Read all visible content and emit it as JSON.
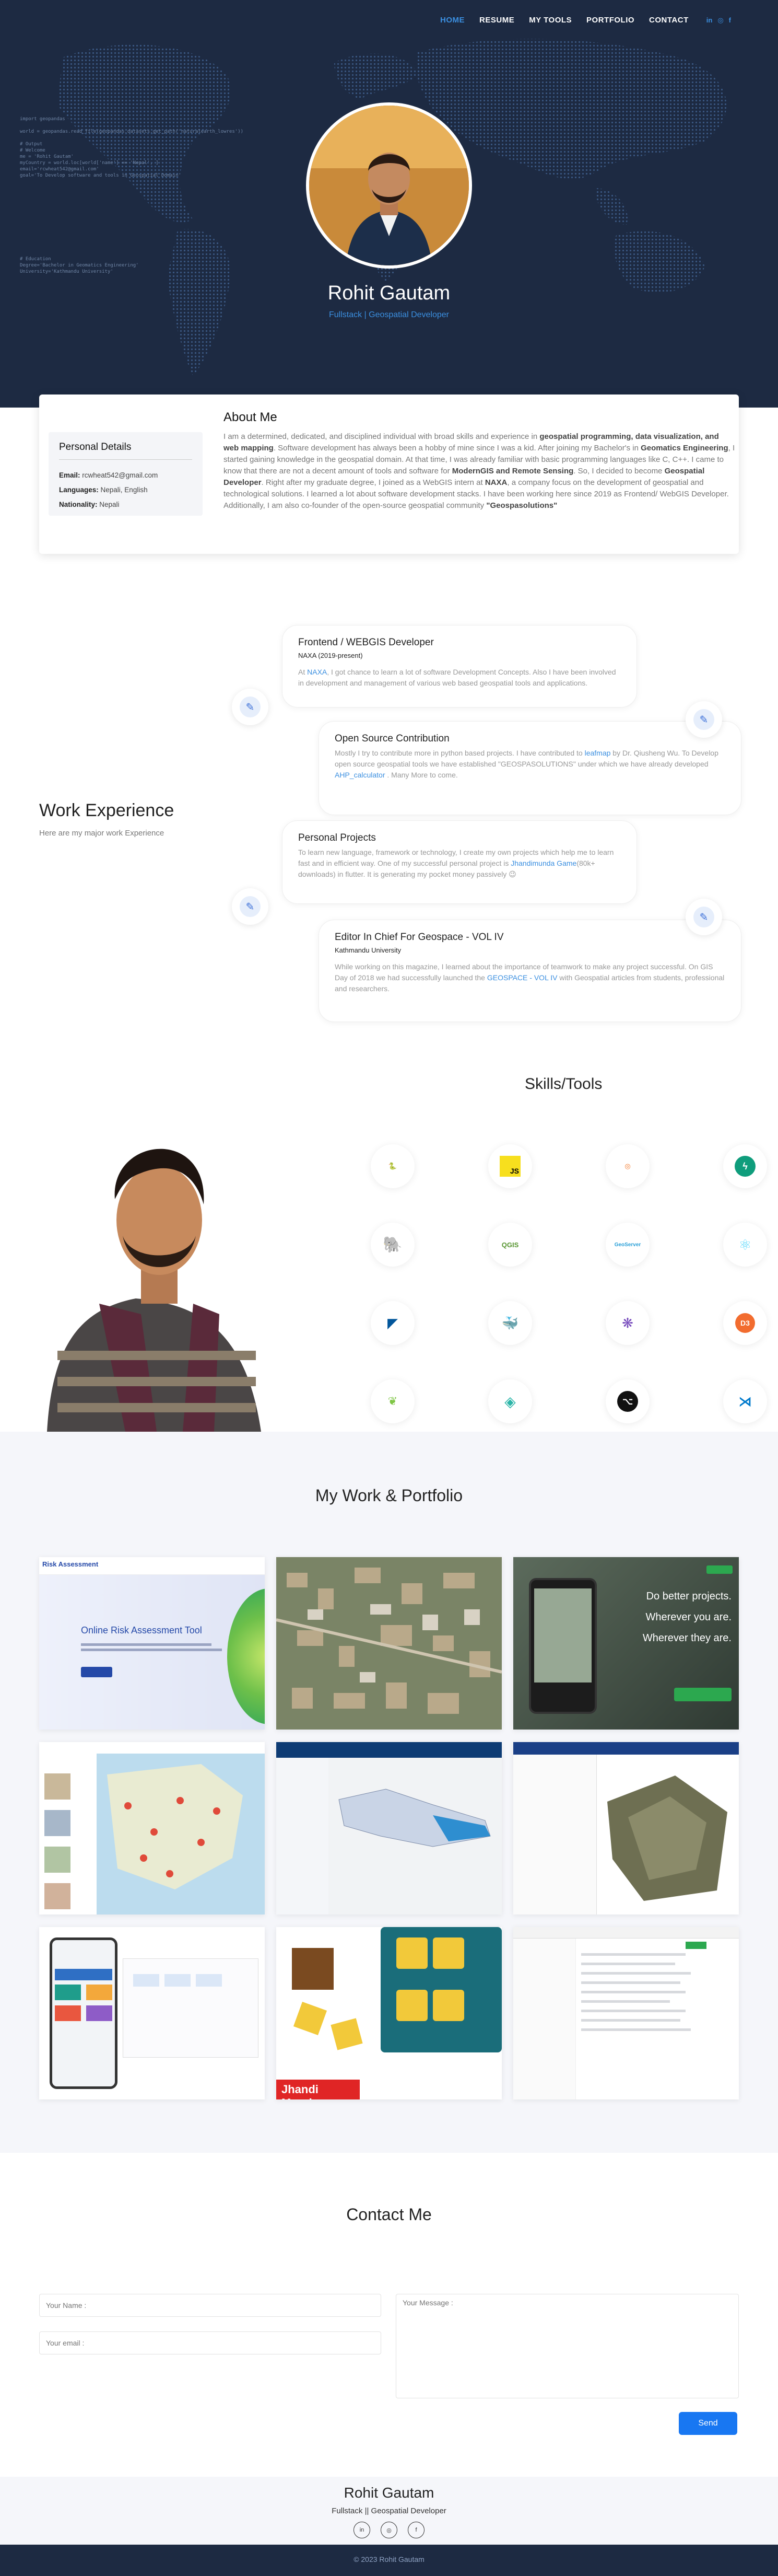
{
  "nav": {
    "items": [
      "HOME",
      "RESUME",
      "MY TOOLS",
      "PORTFOLIO",
      "CONTACT"
    ],
    "social": [
      "in",
      "◎",
      "f"
    ]
  },
  "hero": {
    "code_lines_1": "import geopandas\n\nworld = geopandas.read_file(geopandas.datasets.get_path('naturalearth_lowres'))\n\n# Output\n# Welcome\nme = 'Rohit Gautam'\nmyCountry = world.loc[world['name'] == 'Nepal', ]\nemail='rcwheat542@gmail.com'\ngoal='To Develop software and tools in Geospatial Domain'",
    "code_lines_2": "# Education\nDegree='Bachelor in Geomatics Engineering'\nUniversity='Kathmandu University'",
    "name": "Rohit Gautam",
    "subtitle": "Fullstack | Geospatial Developer"
  },
  "about": {
    "title": "About Me",
    "personal": {
      "heading": "Personal Details",
      "email_label": "Email:",
      "email": "rcwheat542@gmail.com",
      "languages_label": "Languages:",
      "languages": "Nepali, English",
      "nationality_label": "Nationality:",
      "nationality": "Nepali"
    },
    "p1": "I am a determined, dedicated, and disciplined individual with broad skills and experience in ",
    "b1": "geospatial programming, data visualization, and web mapping",
    "p2": ". Software development has always been a hobby of mine since I was a kid. After joining my Bachelor's in ",
    "b2": "Geomatics Engineering",
    "p3": ", I started gaining knowledge in the geospatial domain. At that time, I was already familiar with basic programming languages like C, C++. I came to know that there are not a decent amount of tools and software for ",
    "b3": "ModernGIS and Remote Sensing",
    "p4": ". So, I decided to become ",
    "b4": "Geospatial Developer",
    "p5": ". Right after my graduate degree, I joined as a WebGIS intern at ",
    "b5": "NAXA",
    "p6": ", a company focus on the development of geospatial and technological solutions. I learned a lot about software development stacks. I have been working here since 2019 as Frontend/ WebGIS Developer. Additionally, I am also co-founder of the open-source geospatial community ",
    "b6": "\"Geospasolutions\""
  },
  "work": {
    "title": "Work Experience",
    "subtitle": "Here are my major work Experience",
    "items": [
      {
        "title": "Frontend / WEBGIS Developer",
        "org": "NAXA (2019-present)",
        "t1": "At ",
        "link": "NAXA",
        "t2": ", I got chance to learn a lot of software Development Concepts. Also I have been involved in development and management of various web based geospatial tools and applications."
      },
      {
        "title": "Open Source Contribution",
        "t1": "Mostly I try to contribute more in python based projects. I have contributed to ",
        "link": "leafmap",
        "t2": " by Dr. Qiusheng Wu. To Develop open source geospatial tools we have established \"GEOSPASOLUTIONS\" under which we have already developed ",
        "link2": "AHP_calculator",
        "t3": " . Many More to come."
      },
      {
        "title": "Personal Projects",
        "t1": "To learn new language, framework or technology, I create my own projects which help me to learn fast and in efficient way. One of my successful personal project is ",
        "link": "Jhandimunda Game",
        "t2": "(80k+ downloads) in flutter. It is generating my pocket money passively 😉"
      },
      {
        "title": "Editor In Chief For Geospace - VOL IV",
        "org": "Kathmandu University",
        "t1": "While working on this magazine, I learned about the importance of teamwork to make any project successful. On GIS Day of 2018 we had successfully launched the ",
        "link": "GEOSPACE - VOL IV",
        "t2": " with Geospatial articles from students, professional and researchers."
      }
    ]
  },
  "skills": {
    "title": "Skills/Tools",
    "items": [
      "Python",
      "JS",
      "Jupyter",
      "Vercel",
      "PostgreSQL",
      "QGIS",
      "GeoServer",
      "React",
      "Flutter",
      "Docker",
      "Redux",
      "Django",
      "Leaflet",
      "Mapbox",
      "GitHub",
      "VS Code"
    ]
  },
  "portfolio": {
    "title": "My Work & Portfolio",
    "risk_title": "Risk Assessment",
    "risk_heading": "Online Risk Assessment Tool",
    "mob_line1": "Do better projects.",
    "mob_line2": "Wherever you are.",
    "mob_line3": "Wherever they are.",
    "jhandi": "Jhandi Munda"
  },
  "contact": {
    "title": "Contact Me",
    "name_ph": "Your Name :",
    "email_ph": "Your email :",
    "msg_ph": "Your Message :",
    "send": "Send"
  },
  "footer": {
    "name": "Rohit Gautam",
    "subtitle": "Fullstack || Geospatial Developer",
    "icons": [
      "in",
      "◎",
      "f"
    ],
    "copyright": "© 2023 Rohit Gautam"
  }
}
